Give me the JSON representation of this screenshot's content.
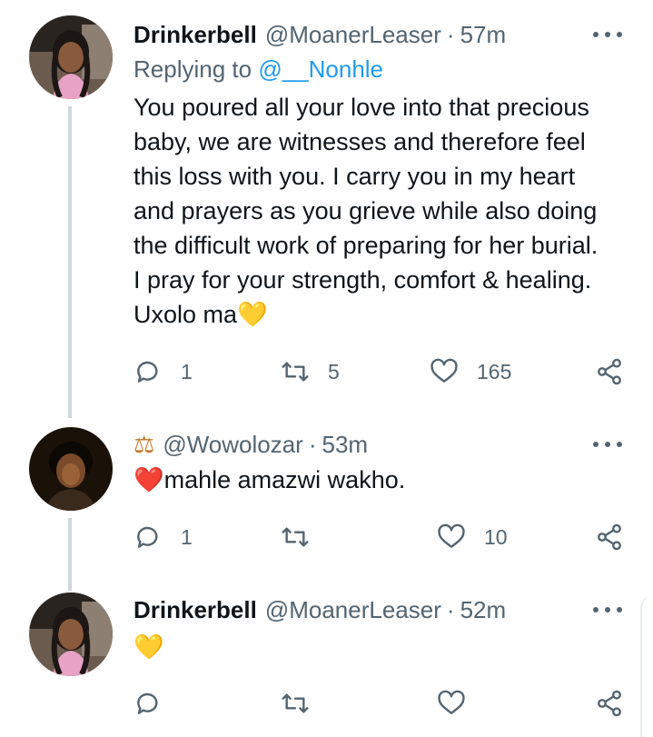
{
  "tweets": [
    {
      "display_name": "Drinkerbell",
      "handle": "@MoanerLeaser",
      "separator": "·",
      "time": "57m",
      "reply_prefix": "Replying to",
      "reply_mention": "@__Nonhle",
      "text": "You poured all your love into that precious\nbaby, we are witnesses and therefore feel\nthis loss with you. I carry you in my heart\nand prayers as you grieve while also doing\nthe difficult work of preparing for her burial.\nI pray for your strength, comfort & healing.\nUxolo ma💛",
      "replies": "1",
      "retweets": "5",
      "likes": "165"
    },
    {
      "display_name": "⚖",
      "handle": "@Wowolozar",
      "separator": "·",
      "time": "53m",
      "text": "❤️mahle amazwi wakho.",
      "replies": "1",
      "retweets": "",
      "likes": "10"
    },
    {
      "display_name": "Drinkerbell",
      "handle": "@MoanerLeaser",
      "separator": "·",
      "time": "52m",
      "text": "💛",
      "replies": "",
      "retweets": "",
      "likes": ""
    }
  ],
  "icons": {
    "reply": "reply-icon",
    "retweet": "retweet-icon",
    "like": "heart-icon",
    "share": "share-icon",
    "more": "more-icon"
  },
  "colors": {
    "text": "#0f1419",
    "secondary": "#536471",
    "link": "#1d9bf0",
    "thread_line": "#cfd9de"
  }
}
